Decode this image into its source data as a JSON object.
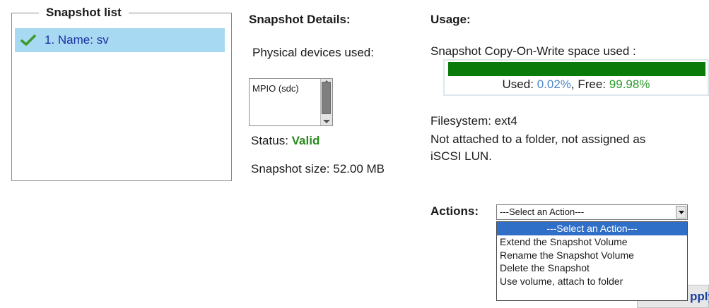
{
  "snapshot_list": {
    "legend": "Snapshot list",
    "items": [
      {
        "label": "1. Name: sv",
        "icon": "check-icon",
        "selected": true
      }
    ]
  },
  "details": {
    "heading": "Snapshot Details:",
    "physical_label": "Physical devices used:",
    "devices": [
      "MPIO (sdc)"
    ],
    "status_label": "Status:",
    "status_value": "Valid",
    "size_text": "Snapshot size: 52.00 MB"
  },
  "usage": {
    "heading": "Usage:",
    "cow_label": "Snapshot Copy-On-Write space used :",
    "used_label": "Used:",
    "used_value": "0.02%",
    "separator": ",",
    "free_label": "Free:",
    "free_value": "99.98%",
    "used_fraction": 0.9998,
    "filesystem_text": "Filesystem: ext4",
    "attach_line1": "Not attached to a folder, not assigned as",
    "attach_line2": "iSCSI LUN."
  },
  "actions": {
    "label": "Actions:",
    "selected_value": "---Select an Action---",
    "options": [
      "---Select an Action---",
      "Extend the Snapshot Volume",
      "Rename the Snapshot Volume",
      "Delete the Snapshot",
      "Use volume, attach to folder"
    ],
    "apply_label": "pply"
  },
  "colors": {
    "selected_bg": "#a8d9f2",
    "valid": "#2b8a1e",
    "bar_fill": "#0a7a0a",
    "used_value": "#4a86c8",
    "free_value": "#2b9a2b",
    "dropdown_highlight": "#2f6fc8"
  }
}
